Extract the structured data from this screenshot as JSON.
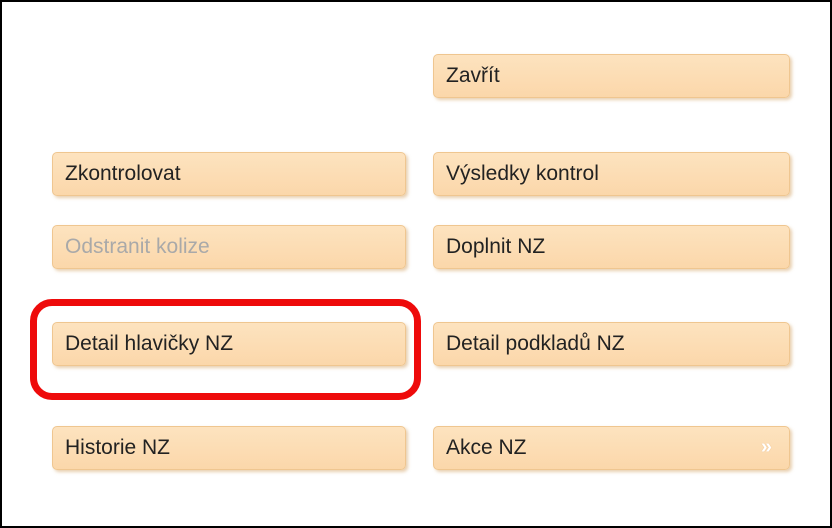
{
  "buttons": {
    "close": "Zavřít",
    "check": "Zkontrolovat",
    "check_results": "Výsledky kontrol",
    "remove_collisions": "Odstranit kolize",
    "supplement_nz": "Doplnit NZ",
    "header_detail": "Detail hlavičky NZ",
    "documents_detail": "Detail podkladů NZ",
    "history_nz": "Historie NZ",
    "actions_nz": "Akce NZ",
    "actions_chevron": "»"
  },
  "states": {
    "remove_collisions_disabled": true
  },
  "highlight": {
    "target": "header_detail",
    "color": "#ee0b0b"
  }
}
